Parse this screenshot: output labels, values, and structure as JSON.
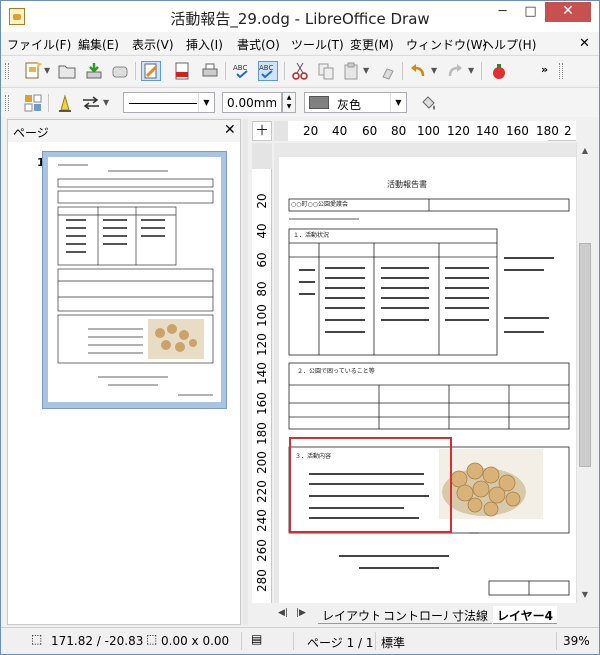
{
  "window": {
    "title": "活動報告_29.odg - LibreOffice Draw",
    "min_label": "─",
    "max_label": "□",
    "close_label": "✕"
  },
  "menu": [
    "ファイル(F)",
    "編集(E)",
    "表示(V)",
    "挿入(I)",
    "書式(O)",
    "ツール(T)",
    "変更(M)",
    "ウィンドウ(W)",
    "ヘルプ(H)"
  ],
  "menu_close": "✕",
  "toolbar1": {
    "icons": [
      "new-document-icon",
      "open-icon",
      "save-icon",
      "mail-icon",
      "edit-mode-icon",
      "export-pdf-icon",
      "print-icon",
      "spellcheck-icon",
      "auto-spellcheck-icon",
      "cut-icon",
      "copy-icon",
      "paste-icon",
      "clone-formatting-icon",
      "undo-icon",
      "redo-icon",
      "show-draw-functions-icon"
    ],
    "more": "»"
  },
  "toolbar2": {
    "line_width": "0.00mm",
    "line_color": "灰色",
    "line_color_hex": "#808080",
    "more": "»"
  },
  "pages_panel": {
    "title": "ページ",
    "close": "✕",
    "page_number": "1"
  },
  "ruler": {
    "corner": "十",
    "h_ticks": [
      "20",
      "40",
      "60",
      "80",
      "100",
      "120",
      "140",
      "160",
      "180",
      "2"
    ],
    "v_ticks": [
      "20",
      "40",
      "60",
      "80",
      "100",
      "120",
      "140",
      "160",
      "180",
      "200",
      "220",
      "240",
      "260",
      "280"
    ]
  },
  "layer_tabs": [
    "レイアウト",
    "コントロール",
    "寸法線",
    "レイヤー4"
  ],
  "active_layer": "レイヤー4",
  "status": {
    "position": "171.82 / -20.83",
    "size": "0.00 x 0.00",
    "page": "ページ 1 / 1",
    "master": "標準",
    "zoom": "39%"
  },
  "document": {
    "heading": "活動報告書",
    "org_label": "○○町○○公園愛護会",
    "section1": "１．活動状況",
    "section2": "２．公園で困っていること等",
    "section3": "３．活動内容",
    "photo_caption": ""
  }
}
